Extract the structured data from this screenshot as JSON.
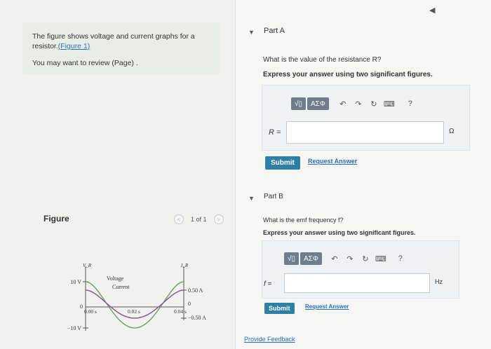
{
  "problem": {
    "line1": "The figure shows voltage and current graphs for a",
    "line2_prefix": "resistor.",
    "figure_link": "(Figure 1)",
    "review": "You may want to review (Page) ."
  },
  "figure": {
    "label": "Figure",
    "pager": "1 of 1",
    "prev": "<",
    "next": ">"
  },
  "graph": {
    "v_axis": "V_R",
    "i_axis": "I_R",
    "v_plus": "10 V",
    "v_zero": "0",
    "v_minus": "−10 V",
    "legend_voltage": "Voltage",
    "legend_current": "Current",
    "i_plus": "0.50 A",
    "i_zero": "0",
    "i_minus": "−0.50 A",
    "t0": "0.00 s",
    "t1": "0.02 s",
    "t2": "0.04 s"
  },
  "partA": {
    "caret": "▼",
    "title": "Part A",
    "question": "What is the value of the resistance R?",
    "instruction": "Express your answer using two significant figures.",
    "toolbar": {
      "sqrt": "√▯",
      "greek": "AΣΦ",
      "undo": "↶",
      "redo": "↷",
      "reset": "↻",
      "keyboard": "⌨",
      "help": "?"
    },
    "var": "R =",
    "unit": "Ω",
    "submit": "Submit",
    "request": "Request Answer"
  },
  "partB": {
    "caret": "▼",
    "title": "Part B",
    "question": "What is the emf frequency f?",
    "instruction": "Express your answer using two significant figures.",
    "toolbar": {
      "sqrt": "√▯",
      "greek": "AΣΦ",
      "undo": "↶",
      "redo": "↷",
      "reset": "↻",
      "keyboard": "⌨",
      "help": "?"
    },
    "var": "f =",
    "unit": "Hz",
    "submit": "Submit",
    "request": "Request Answer"
  },
  "feedback": "Provide Feedback"
}
